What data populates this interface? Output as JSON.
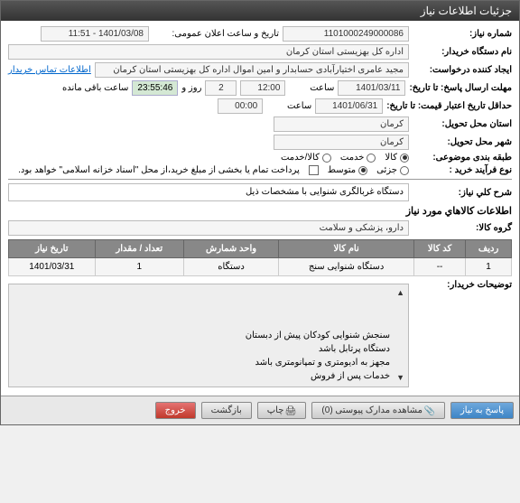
{
  "titlebar": "جزئیات اطلاعات نیاز",
  "fields": {
    "need_no_lbl": "شماره نیاز:",
    "need_no": "1101000249000086",
    "pub_dt_lbl": "تاریخ و ساعت اعلان عمومی:",
    "pub_dt": "1401/03/08 - 11:51",
    "buyer_lbl": "نام دستگاه خریدار:",
    "buyer": "اداره کل بهزیستی استان کرمان",
    "requester_lbl": "ایجاد کننده درخواست:",
    "requester": "مجید عامری اختیارآبادی حسابدار و امین اموال اداره کل بهزیستی استان کرمان",
    "contact_link": "اطلاعات تماس خریدار",
    "deadline_lbl": "مهلت ارسال پاسخ: تا تاریخ:",
    "deadline_date": "1401/03/11",
    "time_lbl": "ساعت",
    "deadline_time": "12:00",
    "days_lbl": "روز و",
    "days": "2",
    "remain_time": "23:55:46",
    "remain_lbl": "ساعت باقی مانده",
    "validity_lbl": "حداقل تاریخ اعتبار قیمت: تا تاریخ:",
    "validity_date": "1401/06/31",
    "validity_time": "00:00",
    "exec_city_lbl": "استان محل تحویل:",
    "exec_city": "کرمان",
    "deliv_city_lbl": "شهر محل تحویل:",
    "deliv_city": "کرمان",
    "subject_cat_lbl": "طبقه بندی موضوعی:",
    "cat_goods": "کالا",
    "cat_service": "خدمت",
    "cat_goodservice": "کالا/خدمت",
    "buy_type_lbl": "نوع فرآیند خرید :",
    "bt_small": "جزئی",
    "bt_medium": "متوسط",
    "bt_note": "پرداخت تمام یا بخشی از مبلغ خرید،از محل \"اسناد خزانه اسلامی\" خواهد بود.",
    "desc_lbl": "شرح کلي نياز:",
    "desc": "دستگاه غربالگری شنوایی با مشخصات ذیل",
    "items_title": "اطلاعات كالاهاي مورد نياز",
    "group_lbl": "گروه کالا:",
    "group": "دارو، پزشکی و سلامت",
    "buyer_notes_lbl": "توضیحات خریدار:",
    "buyer_notes": "سنجش شنوایی کودکان پیش از دبستان\nدستگاه پرتابل باشد\nمجهز به ادیومتری و تمپانومتری باشد\nخدمات پس از فروش"
  },
  "table": {
    "headers": [
      "ردیف",
      "کد کالا",
      "نام کالا",
      "واحد شمارش",
      "تعداد / مقدار",
      "تاریخ نیاز"
    ],
    "rows": [
      [
        "1",
        "--",
        "دستگاه شنوایی سنج",
        "دستگاه",
        "1",
        "1401/03/31"
      ]
    ]
  },
  "buttons": {
    "reply": "پاسخ به نیاز",
    "attach": "مشاهده مدارک پیوستی (0)",
    "print": "چاپ",
    "back": "بازگشت",
    "exit": "خروج"
  }
}
